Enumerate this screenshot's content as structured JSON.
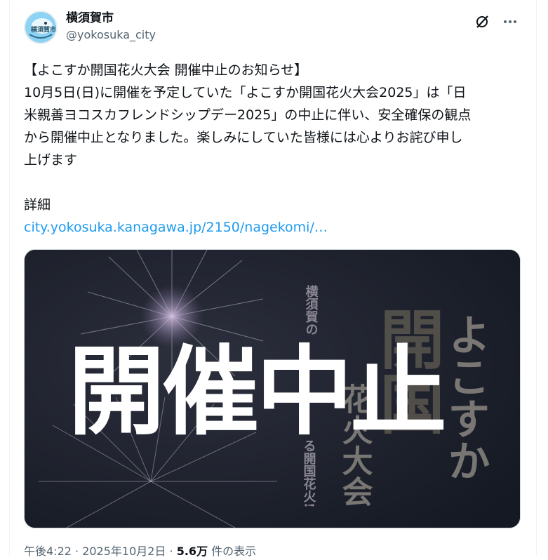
{
  "user": {
    "display_name": "横須賀市",
    "handle": "@yokosuka_city",
    "avatar_text": "横須賀市"
  },
  "post": {
    "line1": "【よこすか開国花火大会 開催中止のお知らせ】",
    "line2": "10月5日(日)に開催を予定していた「よこすか開国花火大会2025」は「日",
    "line3": "米親善ヨコスカフレンドシップデー2025」の中止に伴い、安全確保の観点",
    "line4": "から開催中止となりました。楽しみにしていた皆様には心よりお詫び申し",
    "line5": "上げます",
    "detail_label": "詳細",
    "link_text": "city.yokosuka.kanagawa.jp/2150/nagekomi/…"
  },
  "media": {
    "overlay_text": "開催中止",
    "vertical_title": "よこすか",
    "vertical_kaikoku": "開国",
    "vertical_hanabi": "花火大会",
    "vertical_sub1": "横須賀の",
    "vertical_sub2": "る開国花火!"
  },
  "footer": {
    "time": "午後4:22 · 2025年10月2日 · ",
    "views_count": "5.6万",
    "views_label": " 件の表示"
  },
  "colors": {
    "link": "#1d9bf0",
    "secondary": "#536471",
    "avatar_circle": "#8fd3f4"
  }
}
